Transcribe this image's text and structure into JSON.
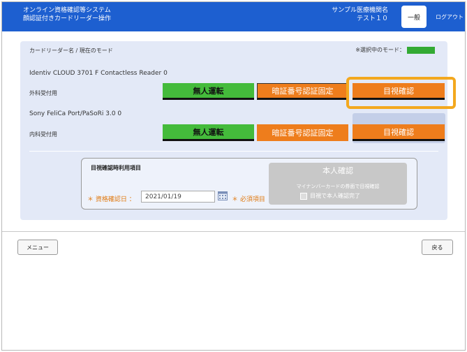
{
  "header": {
    "system_title_line1": "オンライン資格確認等システム",
    "system_title_line2": "顔認証付きカードリーダー操作",
    "facility_line1": "サンプル医療機関名",
    "facility_line2": "テスト１０",
    "role_button": "一般",
    "logout": "ログアウト",
    "color": "#1d5fd0"
  },
  "panel": {
    "breadcrumb": "カードリーダー名 / 現在のモード",
    "current_mode_label": "※選択中のモード：",
    "current_mode_color": "#33aa33",
    "readers": [
      {
        "name": "Identiv CLOUD 3701 F Contactless Reader 0",
        "usage": "外科受付用",
        "buttons": [
          "無人運転",
          "暗証番号認証固定",
          "目視確認"
        ],
        "selected": "目視確認"
      },
      {
        "name": "Sony FeliCa Port/PaSoRi 3.0 0",
        "usage": "内科受付用",
        "buttons": [
          "無人運転",
          "暗証番号認証固定",
          "目視確認"
        ],
        "selected": "目視確認"
      }
    ],
    "visual_check_section": {
      "title": "目視確認時利用項目",
      "date_label": "＊ 資格確認日 ：",
      "date_value": "2021/01/19",
      "required_label": "＊ 必須項目",
      "identity_button": "本人確認",
      "identity_note": "マイナンバーカードの券面で目視確認",
      "identity_check": "目視で本人確認完了"
    }
  },
  "footer": {
    "menu_button": "メニュー",
    "back_button": "戻る"
  },
  "colors": {
    "green": "#44bb3b",
    "orange": "#ee7d1c",
    "highlight": "#f3a81e"
  }
}
